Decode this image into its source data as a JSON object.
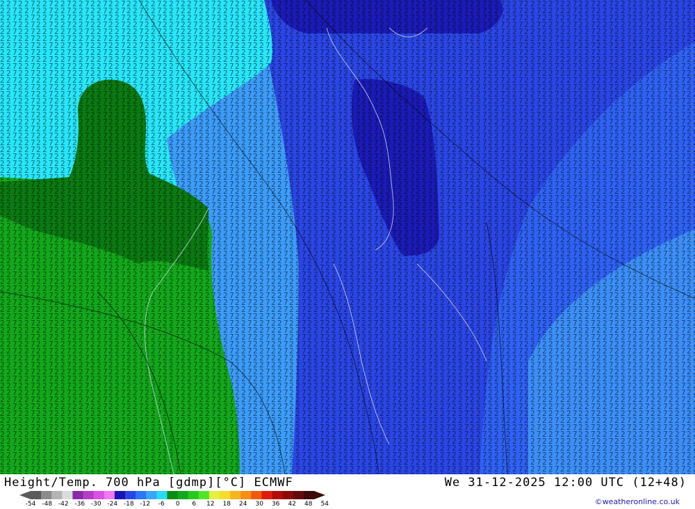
{
  "map": {
    "product": "Height/Temp. 700 hPa [gdmp][°C] ECMWF",
    "valid_time": "We 31-12-2025 12:00 UTC (12+48)",
    "credit": "©weatheronline.co.uk",
    "region_colors": {
      "cold_core": "#1b1bb8",
      "deep_blue": "#2a36e0",
      "mid_blue": "#2f62f4",
      "light_blue": "#3c9cf9",
      "cyan": "#28e6fa",
      "light_green": "#13a81c",
      "dark_green": "#0a7a12"
    }
  },
  "legend": {
    "ticks": [
      "-54",
      "-48",
      "-42",
      "-36",
      "-30",
      "-24",
      "-18",
      "-12",
      "-6",
      "0",
      "6",
      "12",
      "18",
      "24",
      "30",
      "36",
      "42",
      "48",
      "54"
    ],
    "colors": [
      "#5a5a5a",
      "#8c8c8c",
      "#b4b4b4",
      "#dcdcdc",
      "#8a2aa8",
      "#b43cc8",
      "#dc50e6",
      "#f078f0",
      "#1a14b4",
      "#2846e6",
      "#2c78f4",
      "#3ca4f8",
      "#28dcf8",
      "#0a8c14",
      "#14a81c",
      "#28c81e",
      "#50e628",
      "#e6f03c",
      "#f8dc28",
      "#f8b41e",
      "#f88c14",
      "#f05a0a",
      "#dc1e0a",
      "#b40a0a",
      "#8c0a0a",
      "#640a0a",
      "#3c0a0a"
    ]
  }
}
